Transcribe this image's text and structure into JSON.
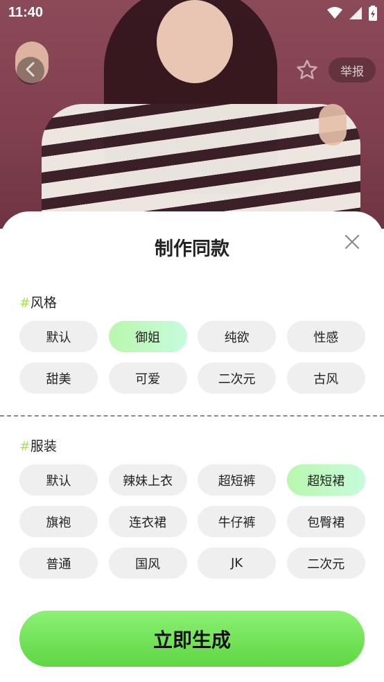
{
  "status_bar": {
    "time": "11:40"
  },
  "header": {
    "report_label": "举报"
  },
  "sheet": {
    "title": "制作同款",
    "style_section": {
      "hash": "#",
      "title": "风格",
      "options": [
        {
          "label": "默认",
          "selected": false
        },
        {
          "label": "御姐",
          "selected": true
        },
        {
          "label": "纯欲",
          "selected": false
        },
        {
          "label": "性感",
          "selected": false
        },
        {
          "label": "甜美",
          "selected": false
        },
        {
          "label": "可爱",
          "selected": false
        },
        {
          "label": "二次元",
          "selected": false
        },
        {
          "label": "古风",
          "selected": false
        }
      ]
    },
    "outfit_section": {
      "hash": "#",
      "title": "服装",
      "options": [
        {
          "label": "默认",
          "selected": false
        },
        {
          "label": "辣妹上衣",
          "selected": false
        },
        {
          "label": "超短裤",
          "selected": false
        },
        {
          "label": "超短裙",
          "selected": true
        },
        {
          "label": "旗袍",
          "selected": false
        },
        {
          "label": "连衣裙",
          "selected": false
        },
        {
          "label": "牛仔裤",
          "selected": false
        },
        {
          "label": "包臀裙",
          "selected": false
        },
        {
          "label": "普通",
          "selected": false
        },
        {
          "label": "国风",
          "selected": false
        },
        {
          "label": "JK",
          "selected": false
        },
        {
          "label": "二次元",
          "selected": false
        }
      ]
    },
    "generate_label": "立即生成"
  },
  "colors": {
    "accent_green": "#5fd644",
    "selected_chip": "#b9f7ad",
    "chip_bg": "#efefef",
    "hash_color": "#a6e35a"
  },
  "icons": [
    "back-arrow-icon",
    "star-outline-icon",
    "close-icon",
    "wifi-icon",
    "signal-icon",
    "battery-icon"
  ]
}
